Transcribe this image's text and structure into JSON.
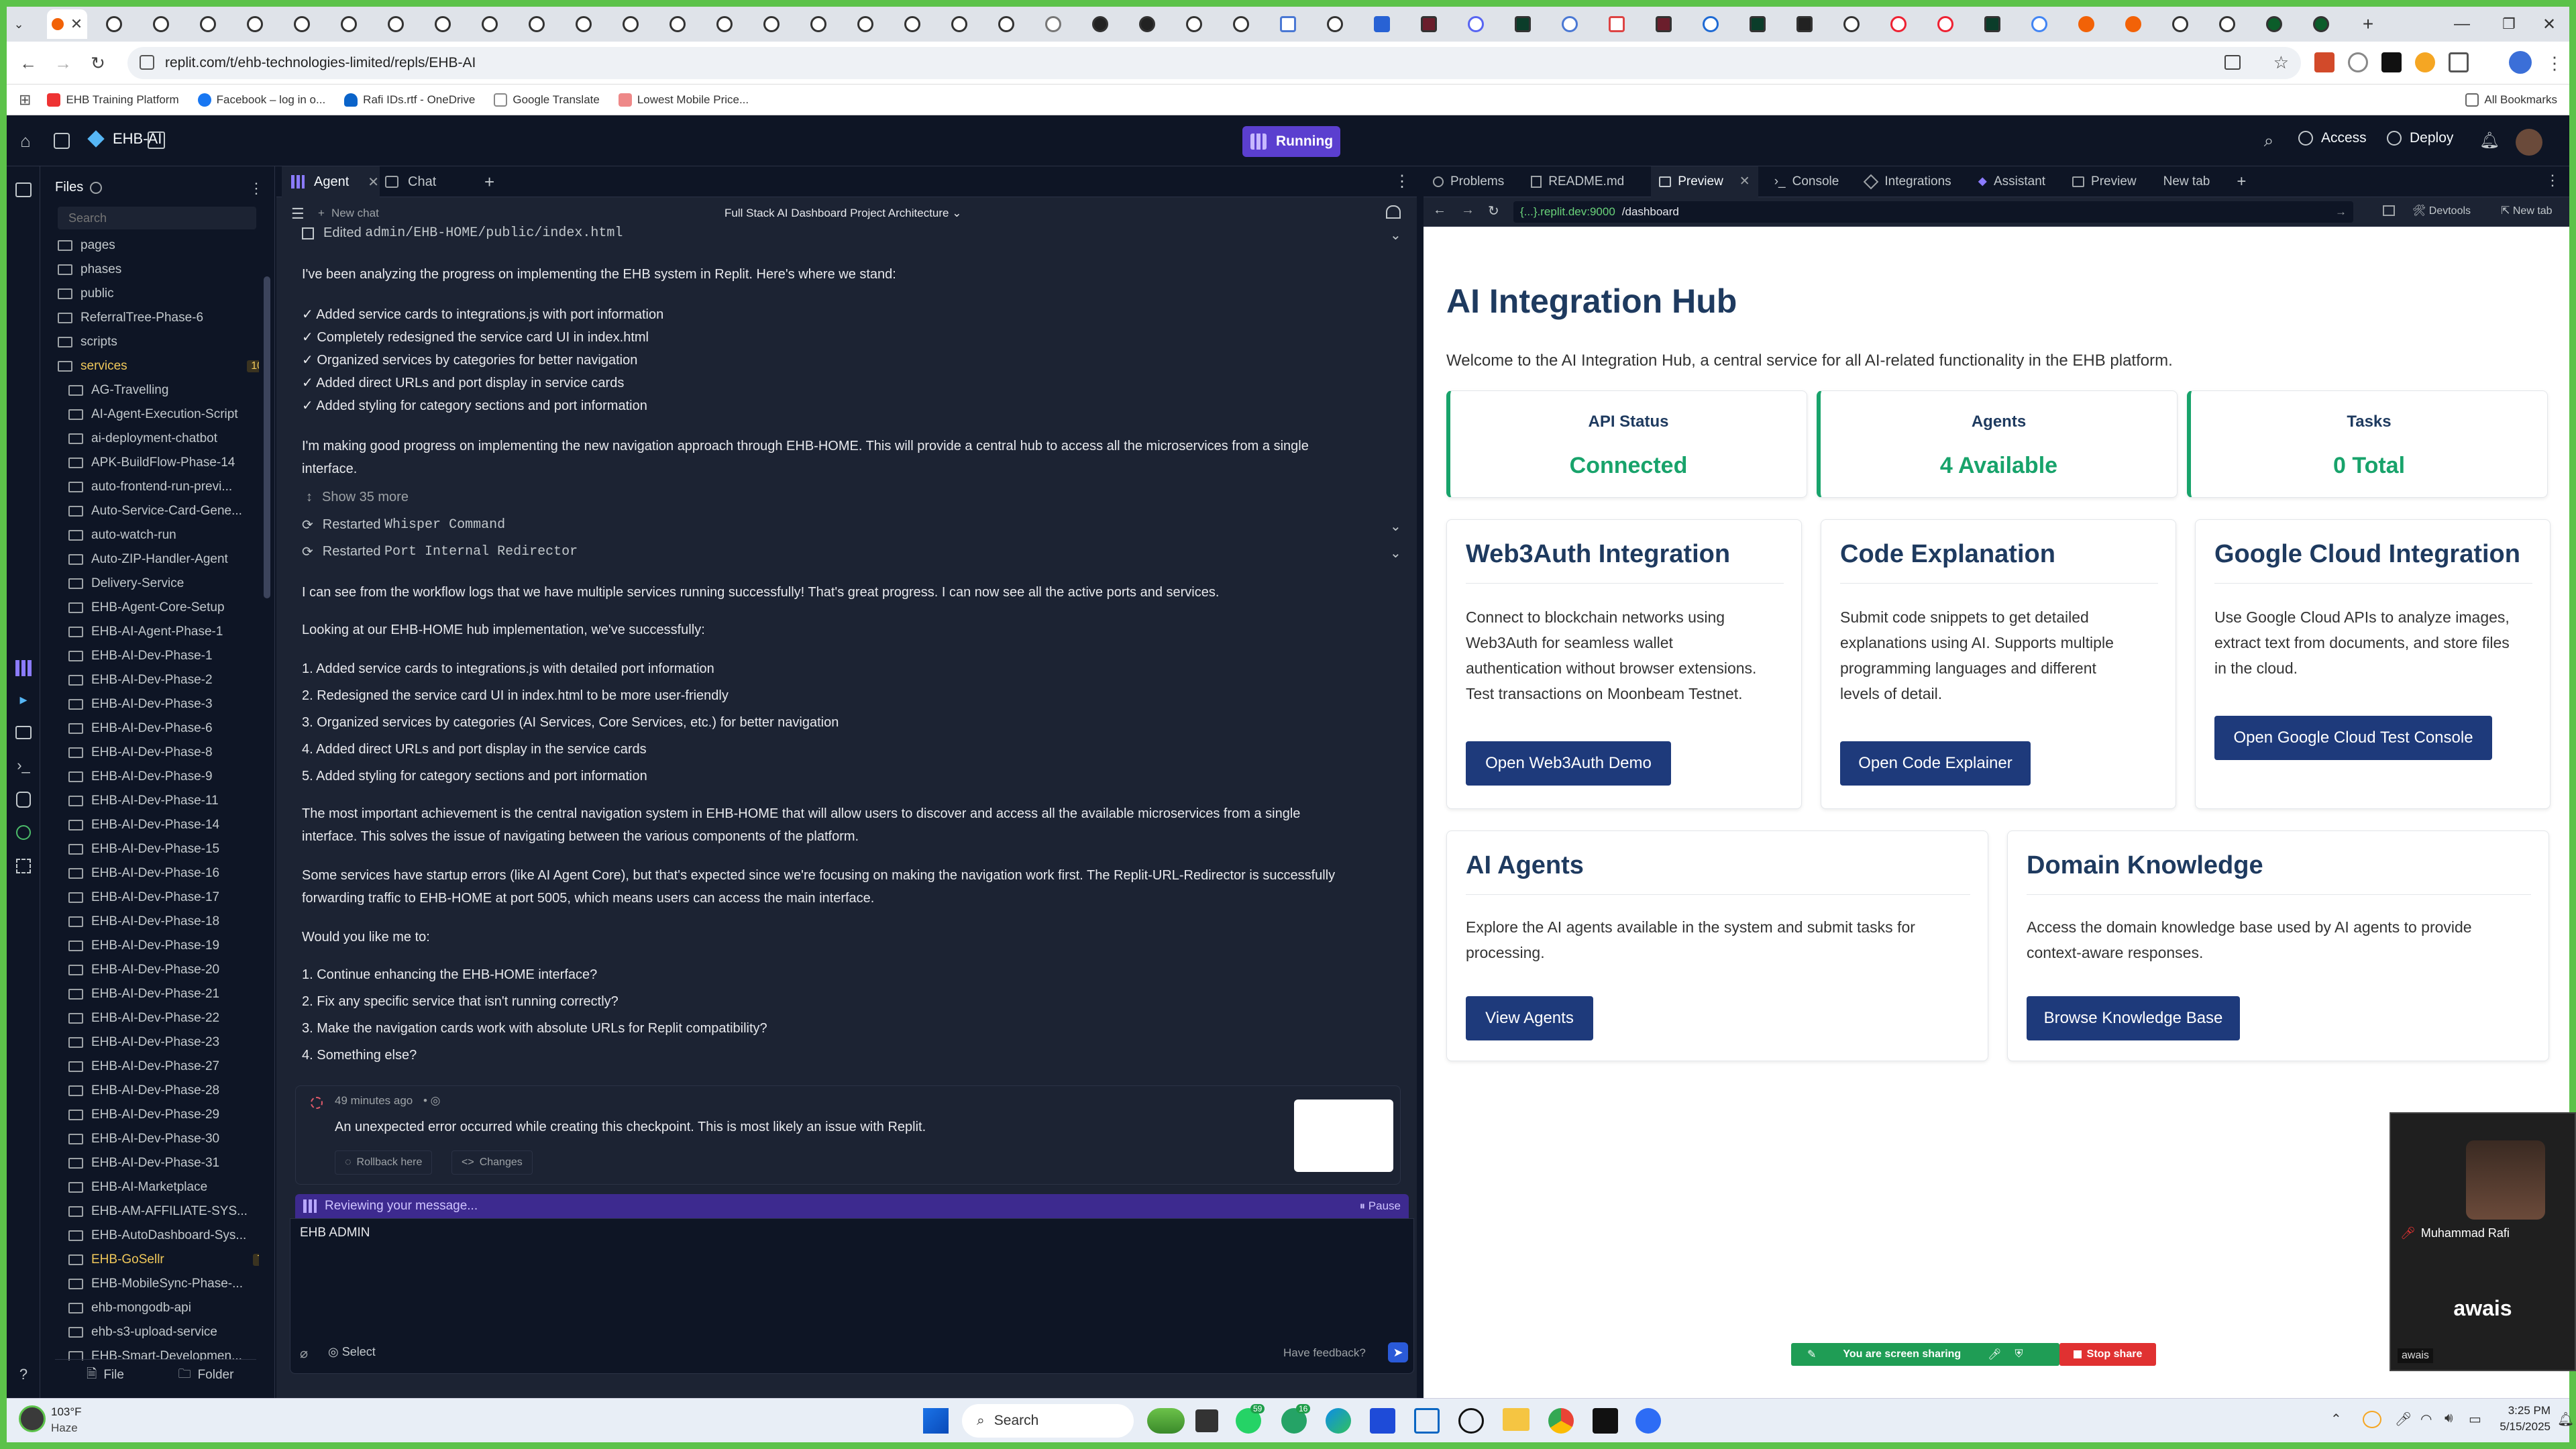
{
  "browser": {
    "url": "replit.com/t/ehb-technologies-limited/repls/EHB-AI",
    "bookmarks": [
      "EHB Training Platform",
      "Facebook – log in o...",
      "Rafi IDs.rtf - OneDrive",
      "Google Translate",
      "Lowest Mobile Price..."
    ],
    "all_bookmarks": "All Bookmarks"
  },
  "replit": {
    "project_name": "EHB-AI",
    "status": "Running",
    "access": "Access",
    "deploy": "Deploy"
  },
  "files": {
    "title": "Files",
    "search_placeholder": "Search",
    "items": [
      {
        "name": "pages"
      },
      {
        "name": "phases"
      },
      {
        "name": "public"
      },
      {
        "name": "ReferralTree-Phase-6"
      },
      {
        "name": "scripts"
      },
      {
        "name": "services",
        "badge": "10"
      },
      {
        "name": "AG-Travelling"
      },
      {
        "name": "AI-Agent-Execution-Script"
      },
      {
        "name": "ai-deployment-chatbot"
      },
      {
        "name": "APK-BuildFlow-Phase-14"
      },
      {
        "name": "auto-frontend-run-previ..."
      },
      {
        "name": "Auto-Service-Card-Gene..."
      },
      {
        "name": "auto-watch-run"
      },
      {
        "name": "Auto-ZIP-Handler-Agent"
      },
      {
        "name": "Delivery-Service"
      },
      {
        "name": "EHB-Agent-Core-Setup"
      },
      {
        "name": "EHB-AI-Agent-Phase-1"
      },
      {
        "name": "EHB-AI-Dev-Phase-1"
      },
      {
        "name": "EHB-AI-Dev-Phase-2"
      },
      {
        "name": "EHB-AI-Dev-Phase-3"
      },
      {
        "name": "EHB-AI-Dev-Phase-6"
      },
      {
        "name": "EHB-AI-Dev-Phase-8"
      },
      {
        "name": "EHB-AI-Dev-Phase-9"
      },
      {
        "name": "EHB-AI-Dev-Phase-11"
      },
      {
        "name": "EHB-AI-Dev-Phase-14"
      },
      {
        "name": "EHB-AI-Dev-Phase-15"
      },
      {
        "name": "EHB-AI-Dev-Phase-16"
      },
      {
        "name": "EHB-AI-Dev-Phase-17"
      },
      {
        "name": "EHB-AI-Dev-Phase-18"
      },
      {
        "name": "EHB-AI-Dev-Phase-19"
      },
      {
        "name": "EHB-AI-Dev-Phase-20"
      },
      {
        "name": "EHB-AI-Dev-Phase-21"
      },
      {
        "name": "EHB-AI-Dev-Phase-22"
      },
      {
        "name": "EHB-AI-Dev-Phase-23"
      },
      {
        "name": "EHB-AI-Dev-Phase-27"
      },
      {
        "name": "EHB-AI-Dev-Phase-28"
      },
      {
        "name": "EHB-AI-Dev-Phase-29"
      },
      {
        "name": "EHB-AI-Dev-Phase-30"
      },
      {
        "name": "EHB-AI-Dev-Phase-31"
      },
      {
        "name": "EHB-AI-Marketplace"
      },
      {
        "name": "EHB-AM-AFFILIATE-SYS..."
      },
      {
        "name": "EHB-AutoDashboard-Sys..."
      },
      {
        "name": "EHB-GoSellr",
        "badge": "7"
      },
      {
        "name": "EHB-MobileSync-Phase-..."
      },
      {
        "name": "ehb-mongodb-api"
      },
      {
        "name": "ehb-s3-upload-service"
      },
      {
        "name": "EHB-Smart-Developmen..."
      }
    ],
    "file_btn": "File",
    "folder_btn": "Folder"
  },
  "agent": {
    "tab_agent": "Agent",
    "tab_chat": "Chat",
    "new_chat": "New chat",
    "chat_title": "Full Stack AI Dashboard Project Architecture",
    "edited_label": "Edited",
    "edited_path": "admin/EHB-HOME/public/index.html",
    "p1": "I've been analyzing the progress on implementing the EHB system in Replit. Here's where we stand:",
    "checks": [
      "✓ Added service cards to integrations.js with port information",
      "✓ Completely redesigned the service card UI in index.html",
      "✓ Organized services by categories for better navigation",
      "✓ Added direct URLs and port display in service cards",
      "✓ Added styling for category sections and port information"
    ],
    "p2": "I'm making good progress on implementing the new navigation approach through EHB-HOME. This will provide a central hub to access all the microservices from a single",
    "p2b": "interface.",
    "show_more": "Show 35 more",
    "restarted_label": "Restarted",
    "restart1": "Whisper Command",
    "restart2": "Port Internal Redirector",
    "p3": "I can see from the workflow logs that we have multiple services running successfully! That's great progress. I can now see all the active ports and services.",
    "p4": "Looking at our EHB-HOME hub implementation, we've successfully:",
    "list1": [
      "1. Added service cards to integrations.js with detailed port information",
      "2. Redesigned the service card UI in index.html to be more user-friendly",
      "3. Organized services by categories (AI Services, Core Services, etc.) for better navigation",
      "4. Added direct URLs and port display in the service cards",
      "5. Added styling for category sections and port information"
    ],
    "p5": "The most important achievement is the central navigation system in EHB-HOME that will allow users to discover and access all the available microservices from a single",
    "p5b": "interface. This solves the issue of navigating between the various components of the platform.",
    "p6": "Some services have startup errors (like AI Agent Core), but that's expected since we're focusing on making the navigation work first. The Replit-URL-Redirector is successfully",
    "p6b": "forwarding traffic to EHB-HOME at port 5005, which means users can access the main interface.",
    "p7": "Would you like me to:",
    "list2": [
      "1. Continue enhancing the EHB-HOME interface?",
      "2. Fix any specific service that isn't running correctly?",
      "3. Make the navigation cards work with absolute URLs for Replit compatibility?",
      "4. Something else?"
    ],
    "checkpoint_time": "49 minutes ago",
    "checkpoint_error": "An unexpected error occurred while creating this checkpoint. This is most likely an issue with Replit.",
    "rollback": "Rollback here",
    "changes": "Changes",
    "reviewing": "Reviewing your message...",
    "pause": "Pause",
    "input_text": "EHB ADMIN",
    "select": "Select",
    "feedback": "Have feedback?"
  },
  "preview_tabs": [
    "Problems",
    "README.md",
    "Preview",
    "Console",
    "Integrations",
    "Assistant",
    "Preview",
    "New tab"
  ],
  "preview": {
    "domain": "{...}.replit.dev:9000",
    "path": "/dashboard",
    "devtools": "Devtools",
    "newtab": "New tab",
    "title": "AI Integration Hub",
    "welcome": "Welcome to the AI Integration Hub, a central service for all AI-related functionality in the EHB platform.",
    "stats": [
      {
        "label": "API Status",
        "value": "Connected"
      },
      {
        "label": "Agents",
        "value": "4 Available"
      },
      {
        "label": "Tasks",
        "value": "0 Total"
      }
    ],
    "cards": [
      {
        "title": "Web3Auth Integration",
        "lines": [
          "Connect to blockchain networks using",
          "Web3Auth for seamless wallet",
          "authentication without browser extensions.",
          "Test transactions on Moonbeam Testnet."
        ],
        "button": "Open Web3Auth Demo"
      },
      {
        "title": "Code Explanation",
        "lines": [
          "Submit code snippets to get detailed",
          "explanations using AI. Supports multiple",
          "programming languages and different",
          "levels of detail."
        ],
        "button": "Open Code Explainer"
      },
      {
        "title": "Google Cloud Integration",
        "lines": [
          "Use Google Cloud APIs to analyze images,",
          "extract text from documents, and store files",
          "in the cloud."
        ],
        "button": "Open Google Cloud Test Console"
      },
      {
        "title": "AI Agents",
        "lines": [
          "Explore the AI agents available in the system and submit tasks for",
          "processing."
        ],
        "button": "View Agents"
      },
      {
        "title": "Domain Knowledge",
        "lines": [
          "Access the domain knowledge base used by AI agents to provide",
          "context-aware responses."
        ],
        "button": "Browse Knowledge Base"
      }
    ]
  },
  "video": {
    "caller": "Muhammad Rafi",
    "self_big": "awais",
    "self_small": "awais"
  },
  "share": {
    "text": "You are screen sharing",
    "stop": "Stop share"
  },
  "taskbar": {
    "weather_temp": "103°F",
    "weather_desc": "Haze",
    "search": "Search",
    "badge1": "59",
    "badge2": "16",
    "time": "3:25 PM",
    "date": "5/15/2025"
  },
  "colors": {
    "running": "#7b5ce0",
    "accent_green": "#18a36b",
    "primary_blue": "#1e3a7b",
    "folder_yellow": "#f0c85a"
  }
}
